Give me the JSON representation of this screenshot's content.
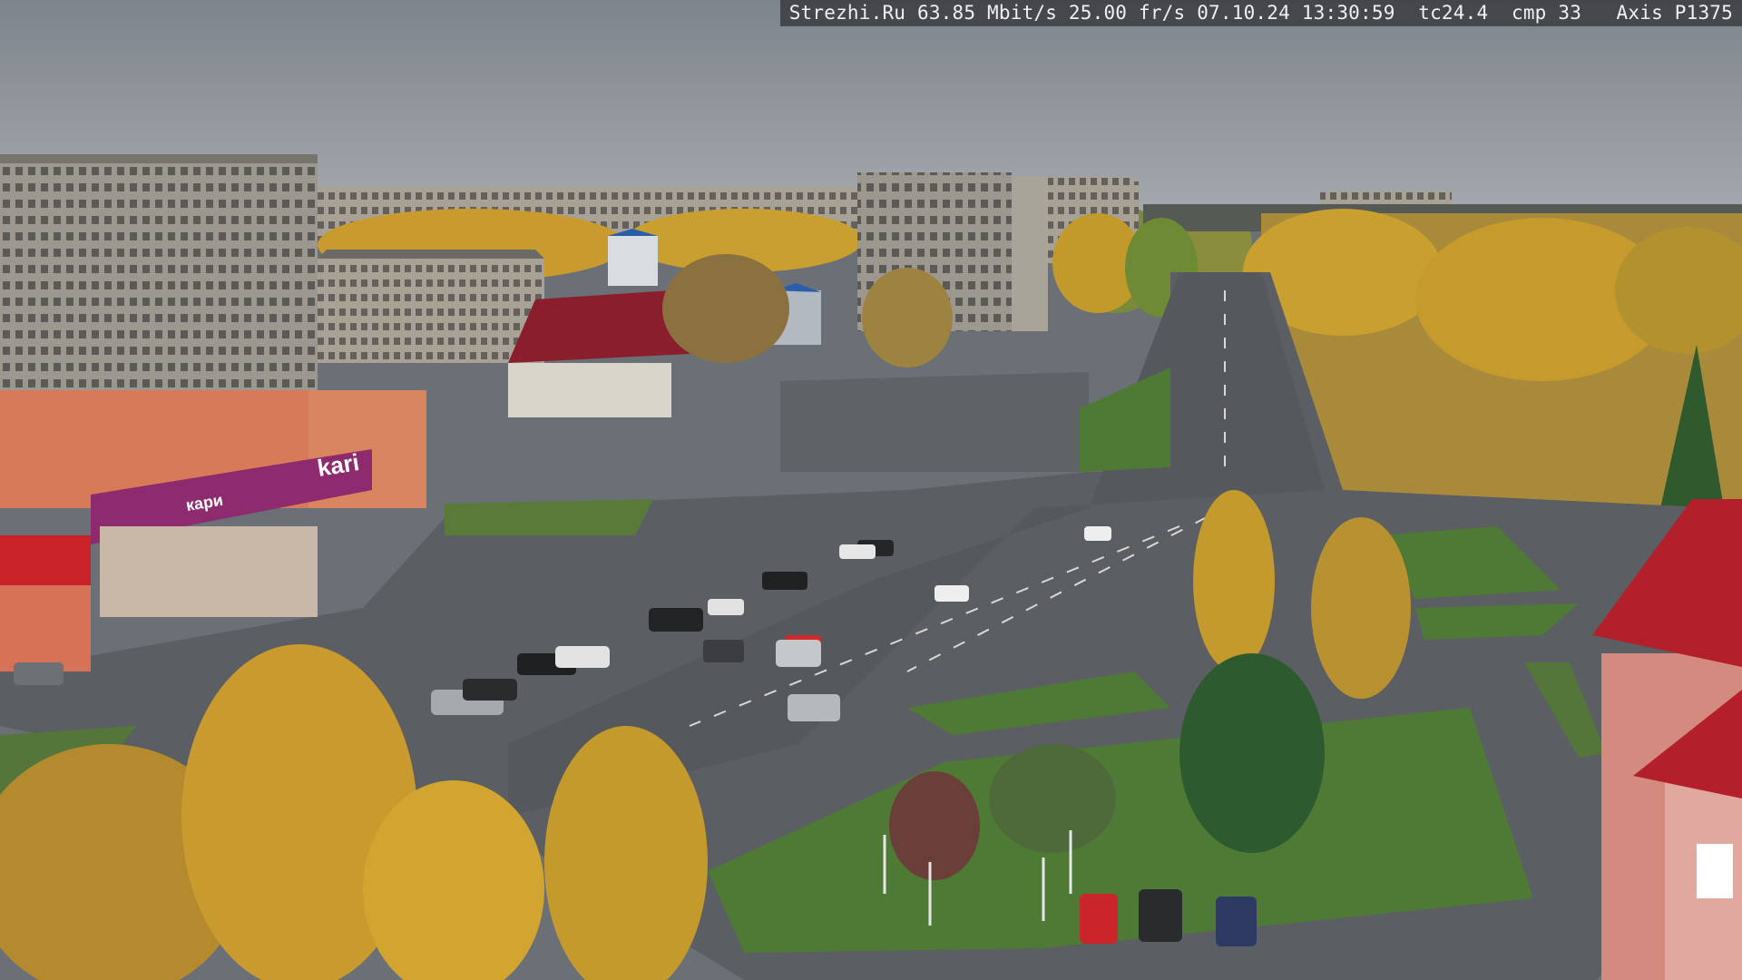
{
  "overlay": {
    "text": "Strezhi.Ru 63.85 Mbit/s 25.00 fr/s 07.10.24 13:30:59  tc24.4  cmp 33   Axis P1375"
  },
  "signs": {
    "store_logo": "kari",
    "store_banner": "кари"
  },
  "colors": {
    "sky": "#8d939a",
    "autumn_foliage": "#c99a2e",
    "asphalt": "#5d6064",
    "grass": "#4f7a36",
    "store_band": "#8e2a6e",
    "roof_red": "#b3202b"
  }
}
